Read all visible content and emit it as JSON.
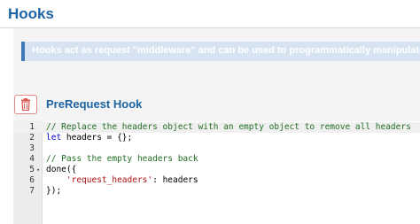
{
  "page": {
    "title": "Hooks"
  },
  "info_banner": {
    "text": "Hooks act as request \"middleware\" and can be used to programmatically manipulate requests"
  },
  "hook_section": {
    "title": "PreRequest Hook",
    "delete_icon": "trash-icon"
  },
  "code_editor": {
    "lines": [
      {
        "number": "1",
        "tokens": [
          {
            "type": "comment",
            "text": "// Replace the headers object with an empty object to remove all headers"
          }
        ]
      },
      {
        "number": "2",
        "tokens": [
          {
            "type": "keyword",
            "text": "let"
          },
          {
            "type": "plain",
            "text": " headers = {};"
          }
        ]
      },
      {
        "number": "3",
        "tokens": []
      },
      {
        "number": "4",
        "tokens": [
          {
            "type": "comment",
            "text": "// Pass the empty headers back"
          }
        ]
      },
      {
        "number": "5",
        "fold": "▾",
        "tokens": [
          {
            "type": "plain",
            "text": "done({"
          }
        ]
      },
      {
        "number": "6",
        "tokens": [
          {
            "type": "plain",
            "text": "    "
          },
          {
            "type": "string",
            "text": "'request_headers'"
          },
          {
            "type": "plain",
            "text": ": headers"
          }
        ]
      },
      {
        "number": "7",
        "tokens": [
          {
            "type": "plain",
            "text": "});"
          }
        ]
      }
    ],
    "colors": {
      "comment": "#236e24",
      "keyword": "#0000cc",
      "string": "#aa1111"
    }
  }
}
